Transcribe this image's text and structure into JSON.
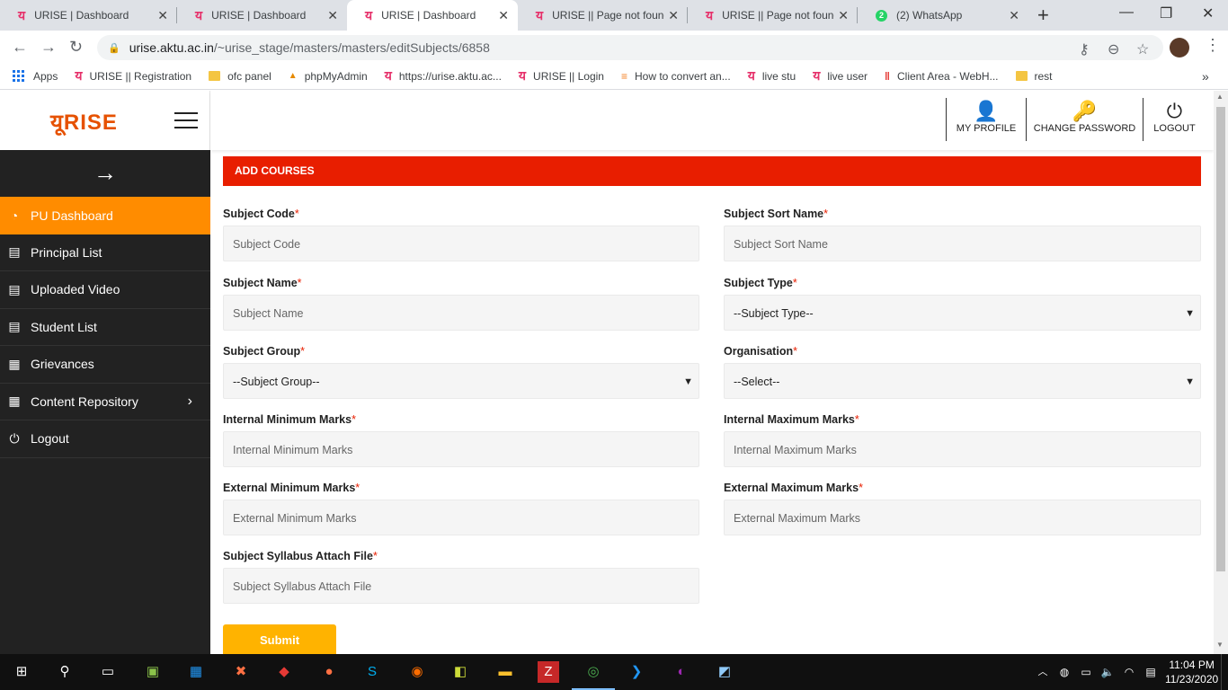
{
  "browser": {
    "tabs": [
      {
        "label": "URISE | Dashboard",
        "icon": "urise-favicon",
        "active": false
      },
      {
        "label": "URISE | Dashboard",
        "icon": "urise-favicon",
        "active": false
      },
      {
        "label": "URISE | Dashboard",
        "icon": "urise-favicon",
        "active": true
      },
      {
        "label": "URISE || Page not found",
        "icon": "urise-favicon",
        "active": false
      },
      {
        "label": "URISE || Page not found",
        "icon": "urise-favicon",
        "active": false
      },
      {
        "label": "(2) WhatsApp",
        "icon": "whatsapp-favicon",
        "active": false
      }
    ],
    "whatsapp_badge": "2",
    "url_host": "urise.aktu.ac.in",
    "url_path": "/~urise_stage/masters/masters/editSubjects/6858",
    "bookmarks": [
      {
        "label": "Apps",
        "icon": "apps-grid-icon"
      },
      {
        "label": "URISE || Registration",
        "icon": "urise-favicon"
      },
      {
        "label": "ofc panel",
        "icon": "folder-icon"
      },
      {
        "label": "phpMyAdmin",
        "icon": "phpmyadmin-icon"
      },
      {
        "label": "https://urise.aktu.ac...",
        "icon": "urise-favicon"
      },
      {
        "label": "URISE || Login",
        "icon": "urise-favicon"
      },
      {
        "label": "How to convert an...",
        "icon": "stackoverflow-icon"
      },
      {
        "label": "live stu",
        "icon": "urise-favicon"
      },
      {
        "label": "live user",
        "icon": "urise-favicon"
      },
      {
        "label": "Client Area - WebH...",
        "icon": "webhost-icon"
      },
      {
        "label": "rest",
        "icon": "folder-icon"
      }
    ],
    "bookmarks_more": "»"
  },
  "app": {
    "logo_text": "यूRISE",
    "sidebar": {
      "items": [
        {
          "label": "PU Dashboard",
          "icon": "speedometer-icon",
          "active": true
        },
        {
          "label": "Principal List",
          "icon": "document-list-icon"
        },
        {
          "label": "Uploaded Video",
          "icon": "document-list-icon"
        },
        {
          "label": "Student List",
          "icon": "document-list-icon"
        },
        {
          "label": "Grievances",
          "icon": "documents-icon"
        },
        {
          "label": "Content Repository",
          "icon": "documents-icon",
          "has_submenu": true
        },
        {
          "label": "Logout",
          "icon": "power-icon"
        }
      ]
    },
    "topnav": {
      "profile": "MY PROFILE",
      "change_password": "CHANGE PASSWORD",
      "logout": "LOGOUT"
    },
    "form": {
      "heading": "ADD COURSES",
      "required_mark": "*",
      "subject_code": {
        "label": "Subject Code",
        "placeholder": "Subject Code"
      },
      "subject_sort_name": {
        "label": "Subject Sort Name",
        "placeholder": "Subject Sort Name"
      },
      "subject_name": {
        "label": "Subject Name",
        "placeholder": "Subject Name"
      },
      "subject_type": {
        "label": "Subject Type",
        "selected": "--Subject Type--"
      },
      "subject_group": {
        "label": "Subject Group",
        "selected": "--Subject Group--"
      },
      "organisation": {
        "label": "Organisation",
        "selected": "--Select--"
      },
      "internal_min": {
        "label": "Internal Minimum Marks",
        "placeholder": "Internal Minimum Marks"
      },
      "internal_max": {
        "label": "Internal Maximum Marks",
        "placeholder": "Internal Maximum Marks"
      },
      "external_min": {
        "label": "External Minimum Marks",
        "placeholder": "External Minimum Marks"
      },
      "external_max": {
        "label": "External Maximum Marks",
        "placeholder": "External Maximum Marks"
      },
      "syllabus": {
        "label": "Subject Syllabus Attach File",
        "placeholder": "Subject Syllabus Attach File"
      },
      "submit": "Submit"
    }
  },
  "taskbar": {
    "time": "11:04 PM",
    "date": "11/23/2020"
  },
  "colors": {
    "accent_orange": "#ff8c00",
    "banner_red": "#e81e00",
    "submit_yellow": "#ffb300",
    "sidebar_bg": "#222222"
  }
}
